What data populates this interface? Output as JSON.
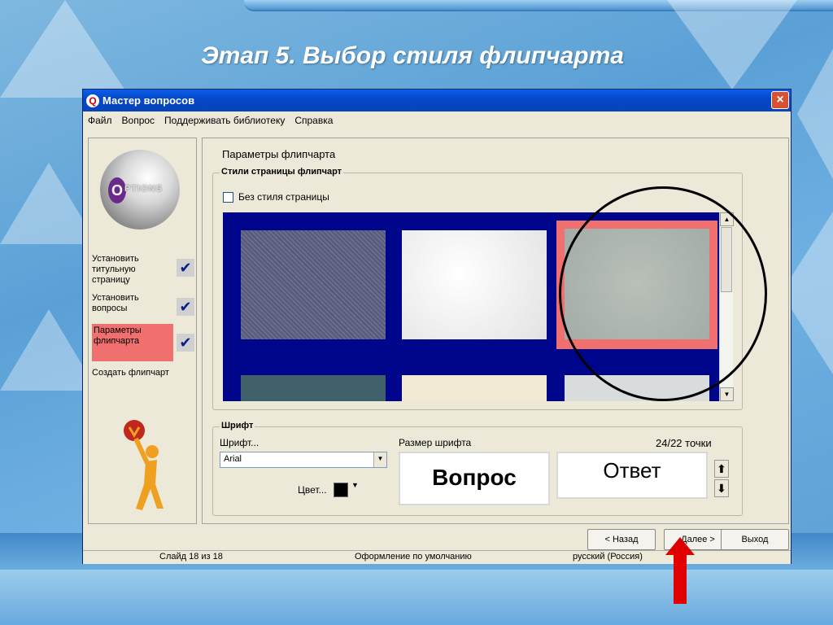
{
  "slide_title": "Этап 5. Выбор стиля флипчарта",
  "window": {
    "icon_letter": "Q",
    "title": "Мастер вопросов",
    "menu": [
      "Файл",
      "Вопрос",
      "Поддерживать библиотеку",
      "Справка"
    ]
  },
  "wizard": {
    "logo_text": "PTIONS",
    "logo_letter": "O",
    "steps": [
      {
        "label": "Установить титульную страницу",
        "checked": true,
        "active": false
      },
      {
        "label": "Установить вопросы",
        "checked": true,
        "active": false
      },
      {
        "label": "Параметры флипчарта",
        "checked": true,
        "active": true
      },
      {
        "label": "Создать флипчарт",
        "checked": false,
        "active": false
      }
    ]
  },
  "panel": {
    "heading": "Параметры флипчарта",
    "styles_group": "Стили страницы флипчарт",
    "no_style_label": "Без стиля страницы",
    "font_group": "Шрифт",
    "font_label": "Шрифт...",
    "font_value": "Arial",
    "color_label": "Цвет...",
    "size_label": "Размер шрифта",
    "size_value": "24/22 точки",
    "preview_question": "Вопрос",
    "preview_answer": "Ответ"
  },
  "buttons": {
    "back": "< Назад",
    "next": "Далее >",
    "exit": "Выход"
  },
  "status": {
    "slide": "Слайд 18 из 18",
    "design": "Оформление по умолчанию",
    "language": "русский (Россия)"
  },
  "colors": {
    "gallery_bg": "#00068c",
    "selected_border": "#f07070",
    "accent_arrow": "#e00000"
  }
}
